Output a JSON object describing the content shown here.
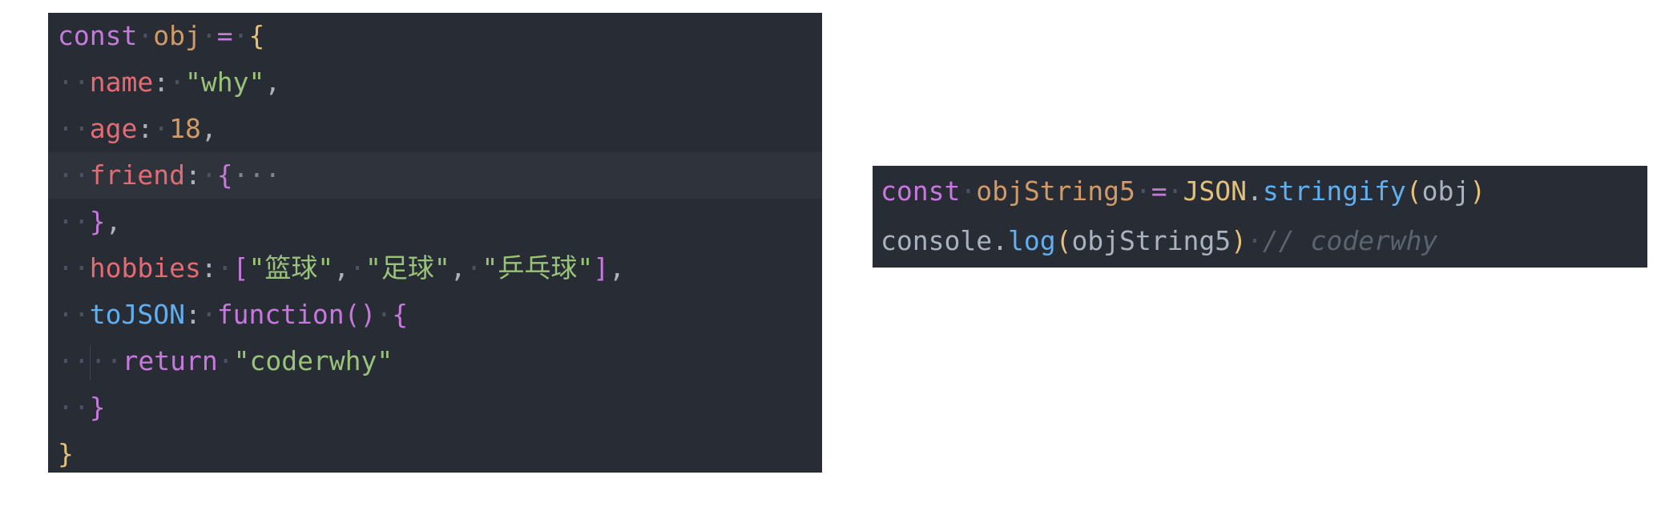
{
  "left_snippet": {
    "l1": {
      "kw": "const",
      "name": "obj",
      "op": "=",
      "open": "{"
    },
    "l2": {
      "key": "name",
      "colon": ":",
      "value": "\"why\"",
      "comma": ","
    },
    "l3": {
      "key": "age",
      "colon": ":",
      "value": "18",
      "comma": ","
    },
    "l4": {
      "key": "friend",
      "colon": ":",
      "open": "{",
      "fold": "···"
    },
    "l5": {
      "close": "}",
      "comma": ","
    },
    "l6": {
      "key": "hobbies",
      "colon": ":",
      "open": "[",
      "v1": "\"篮球\"",
      "sep1": ",",
      "v2": "\"足球\"",
      "sep2": ",",
      "v3": "\"乒乓球\"",
      "close": "]",
      "comma": ","
    },
    "l7": {
      "key": "toJSON",
      "colon": ":",
      "fn": "function",
      "parens": "()",
      "open": "{"
    },
    "l8": {
      "kw": "return",
      "value": "\"coderwhy\""
    },
    "l9": {
      "close": "}"
    },
    "l10": {
      "close": "}"
    }
  },
  "right_snippet": {
    "l1": {
      "kw": "const",
      "name": "objString5",
      "op": "=",
      "obj": "JSON",
      "dot": ".",
      "method": "stringify",
      "open": "(",
      "arg": "obj",
      "close": ")"
    },
    "l2": {
      "obj": "console",
      "dot": ".",
      "method": "log",
      "open": "(",
      "arg": "objString5",
      "close": ")",
      "comment": "// coderwhy"
    }
  }
}
